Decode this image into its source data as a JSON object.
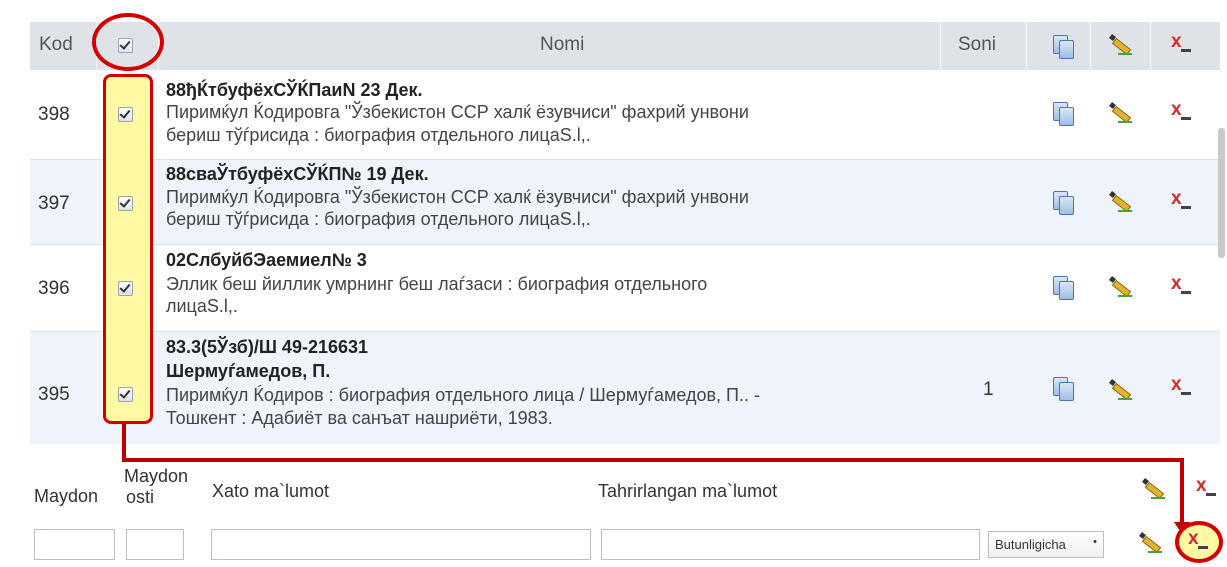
{
  "header": {
    "kod": "Kod",
    "nomi": "Nomi",
    "soni": "Soni"
  },
  "rows": [
    {
      "code": "398",
      "soni": "",
      "lines": [
        "88ђЌтбуфёхСЎЌПаиN 23 Дек.",
        "Пиримќул Ќодировга \"Ўзбекистон ССР халќ ёзувчиси\" фахрий унвони",
        "бериш тўѓрисида : биография отдельного лицаS.l,."
      ]
    },
    {
      "code": "397",
      "soni": "",
      "lines": [
        "88сваЎтбуфёхСЎЌП№ 19 Дек.",
        "Пиримќул Ќодировга \"Ўзбекистон ССР халќ ёзувчиси\" фахрий унвони",
        "бериш тўѓрисида : биография отдельного лицаS.l,."
      ]
    },
    {
      "code": "396",
      "soni": "",
      "lines": [
        "02СлбуйбЭаемиел№ 3",
        "Эллик беш йиллик умрнинг беш лаѓзаси : биография отдельного",
        "лицаS.l,."
      ]
    },
    {
      "code": "395",
      "soni": "1",
      "lines": [
        "83.3(5Ўзб)/Ш 49-216631",
        "Шермуѓамедов, П.",
        "Пиримќул Ќодиров : биография отдельного лица / Шермуѓамедов, П.. -",
        "Тошкент : Адабиёт ва санъат нашриёти, 1983."
      ]
    }
  ],
  "form": {
    "maydon": "Maydon",
    "maydon_osti_1": "Maydon",
    "maydon_osti_2": "osti",
    "xato": "Xato ma`lumot",
    "tahrir": "Tahrirlangan ma`lumot",
    "select_value": "Butunligicha",
    "select_arrow": "•"
  },
  "icons": {
    "copy": "copy-icon",
    "edit": "edit-pencil-icon",
    "delete": "delete-icon",
    "delete_glyph": "x"
  },
  "colors": {
    "highlight_red": "#d40000",
    "highlight_yellow": "#fff9a3",
    "header_bg": "#dfe3e8",
    "alt_row_bg": "#eef4fa"
  }
}
